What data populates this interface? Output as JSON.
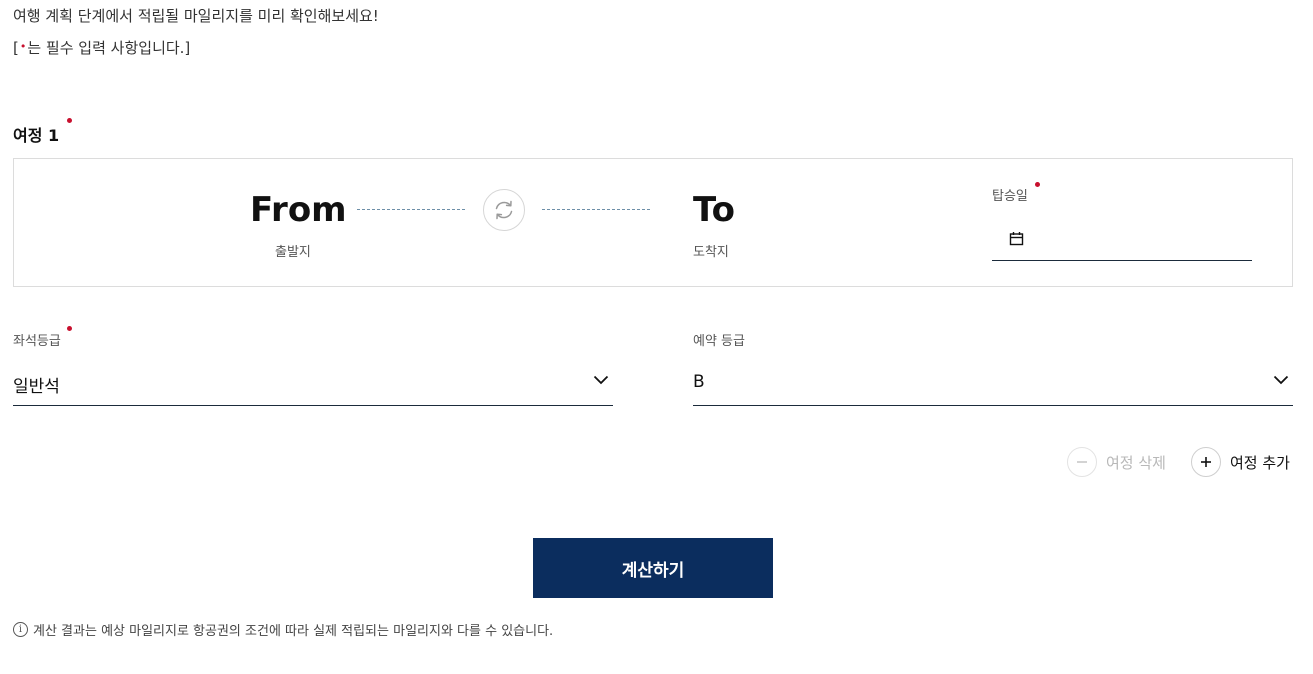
{
  "intro": {
    "text": "여행 계획 단계에서 적립될 마일리지를 미리 확인해보세요!",
    "required_note_open": "[",
    "required_note_dot": "•",
    "required_note_rest": "는 필수 입력 사항입니다.]"
  },
  "journey": {
    "title": "여정 1",
    "origin": {
      "code": "From",
      "label": "출발지"
    },
    "destination": {
      "code": "To",
      "label": "도착지"
    },
    "swap_icon": "swap-arrows-icon",
    "date": {
      "label": "탑승일",
      "value": "",
      "icon": "calendar-icon"
    }
  },
  "cabin_class": {
    "label": "좌석등급",
    "value": "일반석",
    "icon": "chevron-down-icon"
  },
  "booking_class": {
    "label": "예약 등급",
    "value": "B",
    "icon": "chevron-down-icon"
  },
  "actions": {
    "delete_label": "여정 삭제",
    "delete_icon": "minus-icon",
    "add_label": "여정 추가",
    "add_icon": "plus-icon"
  },
  "calculate_label": "계산하기",
  "notice": {
    "icon": "info-icon",
    "icon_glyph": "i",
    "text": "계산 결과는 예상 마일리지로 항공권의 조건에 따라 실제 적립되는 마일리지와 다를 수 있습니다."
  },
  "colors": {
    "required_dot": "#c8102e",
    "primary_button": "#0b2d5e",
    "dashed_line": "#6d8fa8"
  }
}
